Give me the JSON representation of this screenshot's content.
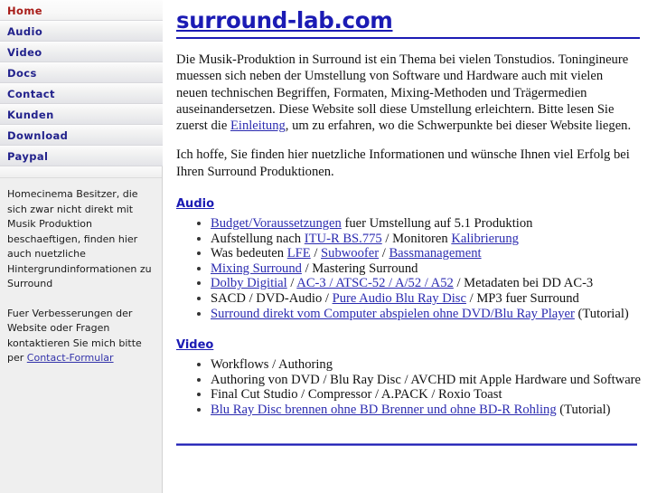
{
  "sidebar": {
    "nav": [
      {
        "label": "Home",
        "active": true
      },
      {
        "label": "Audio",
        "active": false
      },
      {
        "label": "Video",
        "active": false
      },
      {
        "label": "Docs",
        "active": false
      },
      {
        "label": "Contact",
        "active": false
      },
      {
        "label": "Kunden",
        "active": false
      },
      {
        "label": "Download",
        "active": false
      },
      {
        "label": "Paypal",
        "active": false
      }
    ],
    "blurb_1": "Homecinema Besitzer, die sich zwar nicht direkt mit Musik Produktion beschaeftigen, finden hier auch nuetzliche Hintergrundinformationen zu Surround",
    "blurb_2_before": "Fuer Verbesserungen der Website oder Fragen kontaktieren Sie mich bitte per ",
    "blurb_2_link": "Contact-Formular"
  },
  "main": {
    "title": "surround-lab.com",
    "intro_1_a": "Die Musik-Produktion in Surround ist ein Thema bei vielen Tonstudios. Toningineure muessen sich neben der Umstellung von Software und Hardware auch mit vielen neuen technischen Begriffen, Formaten, Mixing-Methoden und Trägermedien auseinandersetzen. Diese Website soll diese Umstellung erleichtern. Bitte lesen Sie zuerst die ",
    "intro_1_link": "Einleitung",
    "intro_1_b": ", um zu erfahren, wo die Schwerpunkte bei dieser Website liegen.",
    "intro_2": "Ich hoffe, Sie finden hier nuetzliche Informationen und wünsche Ihnen viel Erfolg bei Ihren Surround Produktionen.",
    "sections": [
      {
        "heading": "Audio",
        "items": [
          [
            {
              "t": "Budget/Voraussetzungen",
              "link": true
            },
            {
              "t": " fuer Umstellung auf 5.1 Produktion",
              "link": false
            }
          ],
          [
            {
              "t": "Aufstellung nach ",
              "link": false
            },
            {
              "t": "ITU-R BS.775",
              "link": true
            },
            {
              "t": " / Monitoren ",
              "link": false
            },
            {
              "t": "Kalibrierung",
              "link": true
            }
          ],
          [
            {
              "t": "Was bedeuten ",
              "link": false
            },
            {
              "t": "LFE",
              "link": true
            },
            {
              "t": " / ",
              "link": false
            },
            {
              "t": "Subwoofer",
              "link": true
            },
            {
              "t": " / ",
              "link": false
            },
            {
              "t": "Bassmanagement",
              "link": true
            }
          ],
          [
            {
              "t": "Mixing Surround",
              "link": true
            },
            {
              "t": " / Mastering Surround",
              "link": false
            }
          ],
          [
            {
              "t": "Dolby Digitial",
              "link": true
            },
            {
              "t": " / ",
              "link": false
            },
            {
              "t": "AC-3 / ATSC-52 / A/52 / A52",
              "link": true
            },
            {
              "t": " / Metadaten bei DD AC-3",
              "link": false
            }
          ],
          [
            {
              "t": "SACD / DVD-Audio / ",
              "link": false
            },
            {
              "t": "Pure Audio Blu Ray Disc",
              "link": true
            },
            {
              "t": " / MP3 fuer Surround",
              "link": false
            }
          ],
          [
            {
              "t": "Surround direkt vom Computer abspielen ohne DVD/Blu Ray Player",
              "link": true
            },
            {
              "t": " (Tutorial)",
              "link": false
            }
          ]
        ]
      },
      {
        "heading": "Video",
        "items": [
          [
            {
              "t": "Workflows / Authoring",
              "link": false
            }
          ],
          [
            {
              "t": "Authoring von DVD / Blu Ray Disc / AVCHD mit Apple Hardware und Software",
              "link": false
            }
          ],
          [
            {
              "t": "Final Cut Studio / Compressor / A.PACK / Roxio Toast",
              "link": false
            }
          ],
          [
            {
              "t": "Blu Ray Disc brennen ohne BD Brenner und ohne BD-R Rohling",
              "link": true
            },
            {
              "t": " (Tutorial)",
              "link": false
            }
          ]
        ]
      }
    ]
  },
  "colors": {
    "link": "#2b2bb0",
    "heading": "#1b1bb4",
    "nav_text": "#22228c",
    "nav_active_text": "#a81c18",
    "sidebar_bg": "#efefef"
  }
}
